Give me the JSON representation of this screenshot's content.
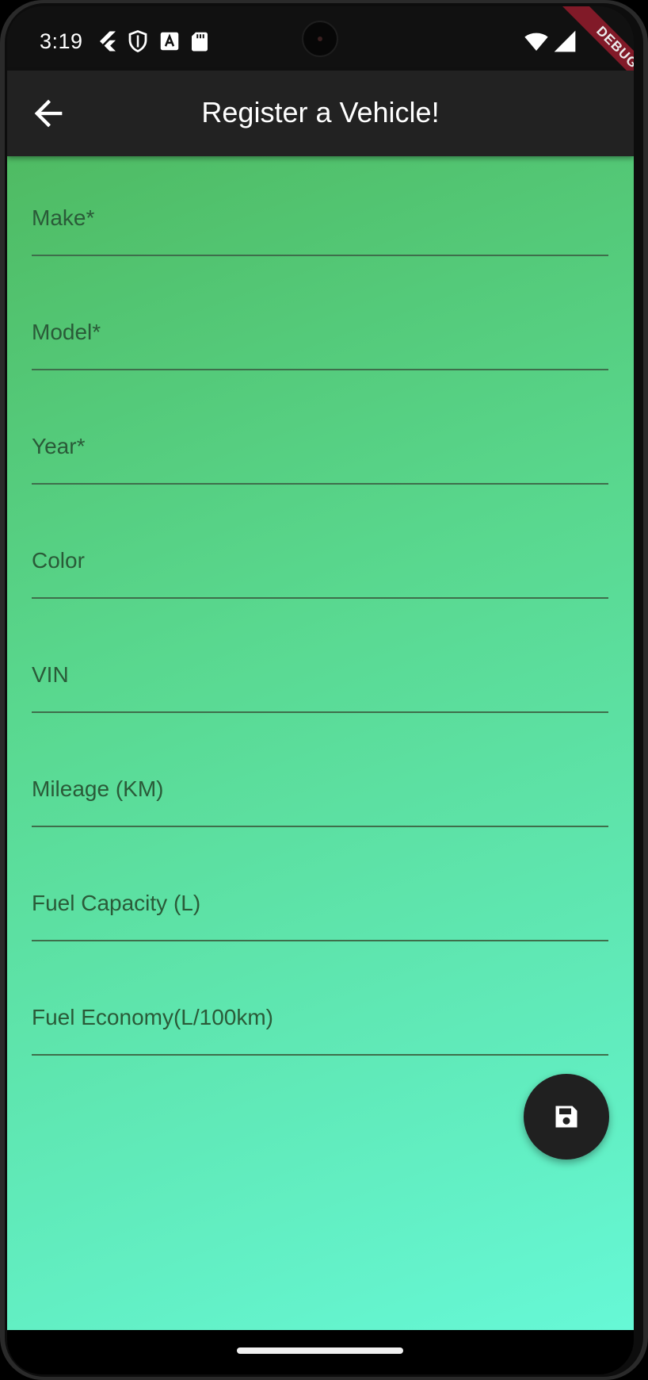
{
  "status_bar": {
    "time": "3:19"
  },
  "debug_banner": "DEBUG",
  "app_bar": {
    "title": "Register a Vehicle!"
  },
  "form": {
    "fields": [
      {
        "label": "Make*"
      },
      {
        "label": "Model*"
      },
      {
        "label": "Year*"
      },
      {
        "label": "Color"
      },
      {
        "label": "VIN"
      },
      {
        "label": "Mileage (KM)"
      },
      {
        "label": "Fuel Capacity (L)"
      },
      {
        "label": "Fuel Economy(L/100km)"
      }
    ]
  },
  "fab": {
    "icon": "save-icon"
  },
  "colors": {
    "gradient_start": "#4fbb63",
    "gradient_end": "#66f8d6",
    "app_bar": "#222222",
    "fab": "#202020"
  }
}
